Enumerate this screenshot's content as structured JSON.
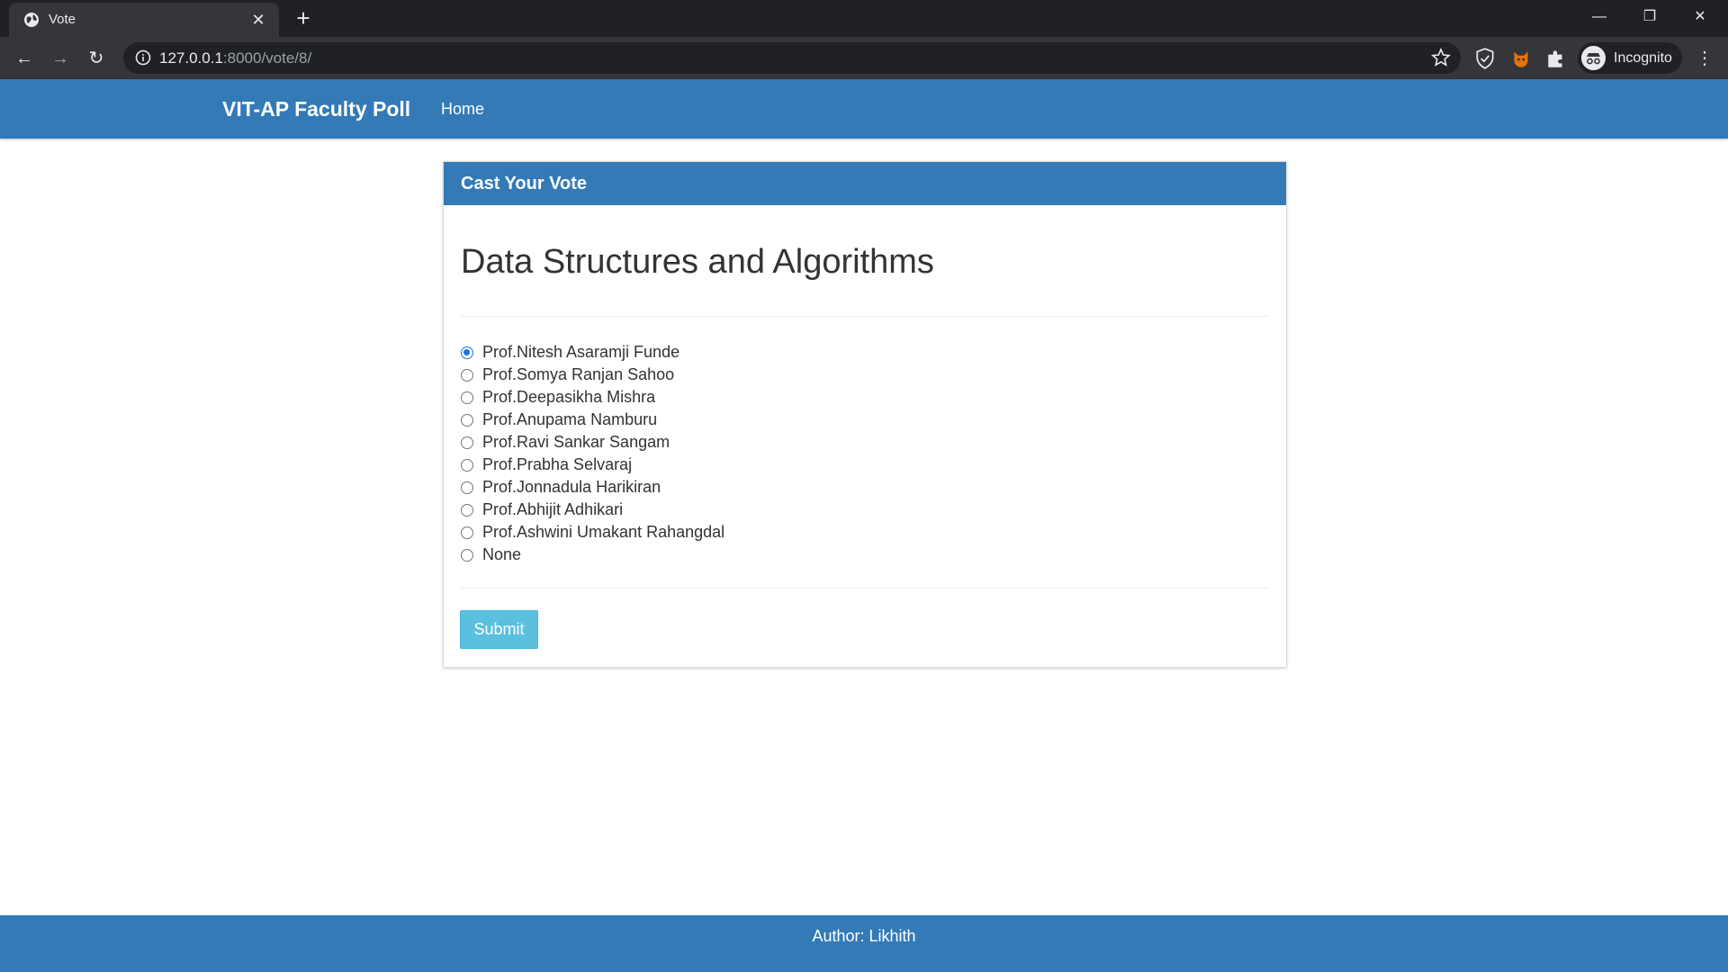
{
  "browser": {
    "tab_title": "Vote",
    "url_host": "127.0.0.1",
    "url_path": ":8000/vote/8/",
    "profile_label": "Incognito"
  },
  "navbar": {
    "brand": "VIT-AP Faculty Poll",
    "home": "Home"
  },
  "panel": {
    "title": "Cast Your Vote",
    "question": "Data Structures and Algorithms",
    "choices": [
      {
        "label": "Prof.Nitesh Asaramji Funde",
        "checked": true
      },
      {
        "label": "Prof.Somya Ranjan Sahoo",
        "checked": false
      },
      {
        "label": "Prof.Deepasikha Mishra",
        "checked": false
      },
      {
        "label": "Prof.Anupama Namburu",
        "checked": false
      },
      {
        "label": "Prof.Ravi Sankar Sangam",
        "checked": false
      },
      {
        "label": "Prof.Prabha Selvaraj",
        "checked": false
      },
      {
        "label": "Prof.Jonnadula Harikiran",
        "checked": false
      },
      {
        "label": "Prof.Abhijit Adhikari",
        "checked": false
      },
      {
        "label": "Prof.Ashwini Umakant Rahangdal",
        "checked": false
      },
      {
        "label": "None",
        "checked": false
      }
    ],
    "submit_label": "Submit"
  },
  "footer": {
    "text": "Author: Likhith"
  },
  "colors": {
    "primary": "#337ab7",
    "submit": "#5bc0de"
  }
}
